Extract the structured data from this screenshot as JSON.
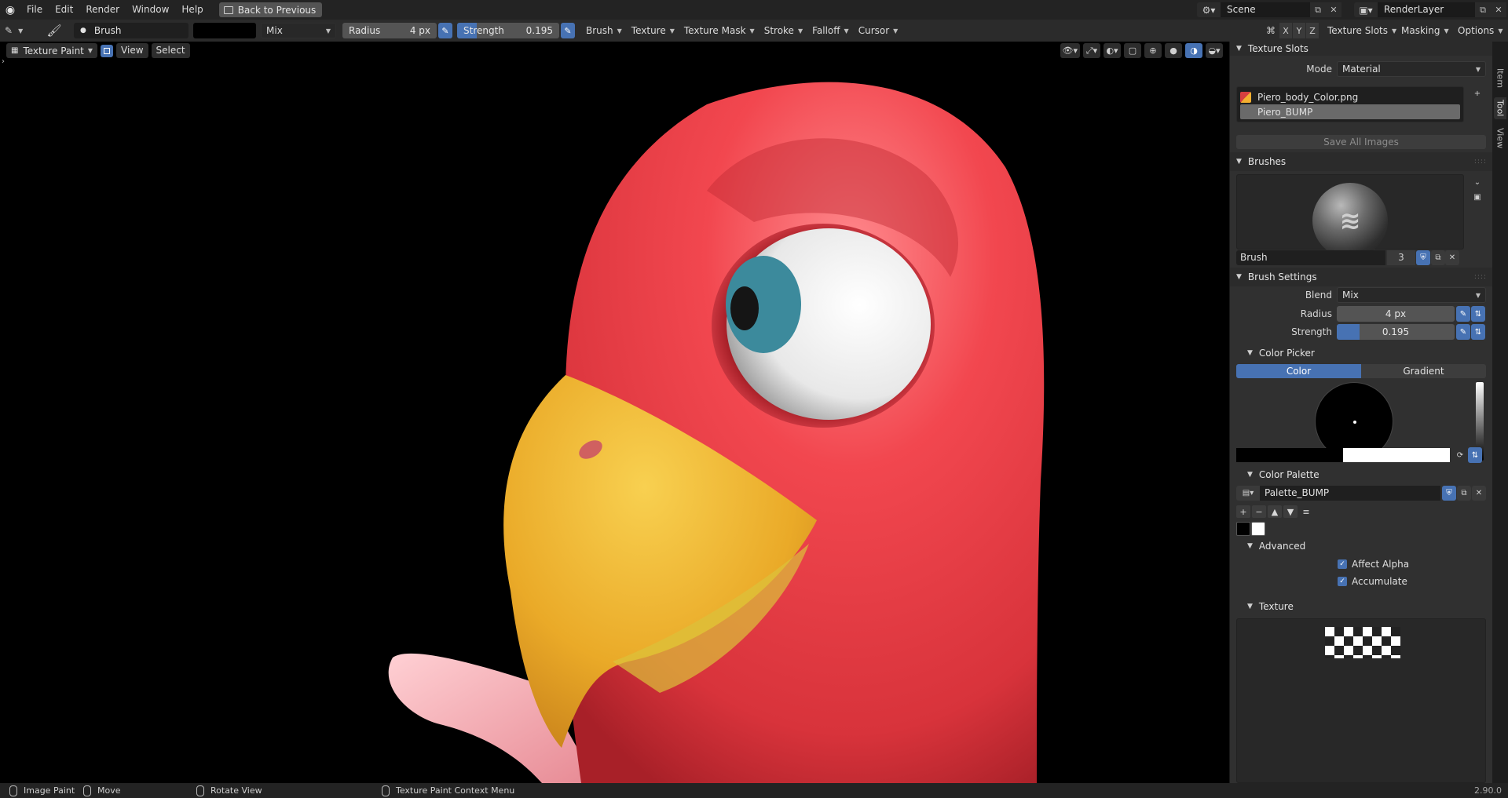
{
  "topbar": {
    "menus": [
      "File",
      "Edit",
      "Render",
      "Window",
      "Help"
    ],
    "back_label": "Back to Previous",
    "scene": "Scene",
    "view_layer": "RenderLayer"
  },
  "toolbar": {
    "brush_name": "Brush",
    "blend": "Mix",
    "radius_label": "Radius",
    "radius_value": "4 px",
    "strength_label": "Strength",
    "strength_value": "0.195",
    "strength_fraction": 0.195,
    "menus": [
      "Brush",
      "Texture",
      "Texture Mask",
      "Stroke",
      "Falloff",
      "Cursor"
    ],
    "axes": [
      "X",
      "Y",
      "Z"
    ],
    "right_menus": [
      "Texture Slots",
      "Masking",
      "Options"
    ]
  },
  "viewport": {
    "mode": "Texture Paint",
    "view": "View",
    "select": "Select"
  },
  "sidebar": {
    "tabs": [
      "Item",
      "Tool",
      "View"
    ],
    "texture_slots": {
      "title": "Texture Slots",
      "mode_label": "Mode",
      "mode_value": "Material",
      "items": [
        "Piero_body_Color.png",
        "Piero_BUMP"
      ],
      "save_all": "Save All Images"
    },
    "brushes": {
      "title": "Brushes",
      "name": "Brush",
      "users": "3"
    },
    "brush_settings": {
      "title": "Brush Settings",
      "blend_label": "Blend",
      "blend_value": "Mix",
      "radius_label": "Radius",
      "radius_value": "4 px",
      "strength_label": "Strength",
      "strength_value": "0.195",
      "strength_fraction": 0.195
    },
    "color_picker": {
      "title": "Color Picker",
      "tab_color": "Color",
      "tab_gradient": "Gradient"
    },
    "color_palette": {
      "title": "Color Palette",
      "name": "Palette_BUMP"
    },
    "advanced": {
      "title": "Advanced",
      "affect_alpha": "Affect Alpha",
      "accumulate": "Accumulate"
    },
    "texture": {
      "title": "Texture"
    }
  },
  "statusbar": {
    "image_paint": "Image Paint",
    "move": "Move",
    "rotate_view": "Rotate View",
    "context_menu": "Texture Paint Context Menu",
    "version": "2.90.0"
  },
  "colors": {
    "accent": "#4772b3",
    "body_red": "#e8404a",
    "beak_yellow": "#f0b830"
  }
}
